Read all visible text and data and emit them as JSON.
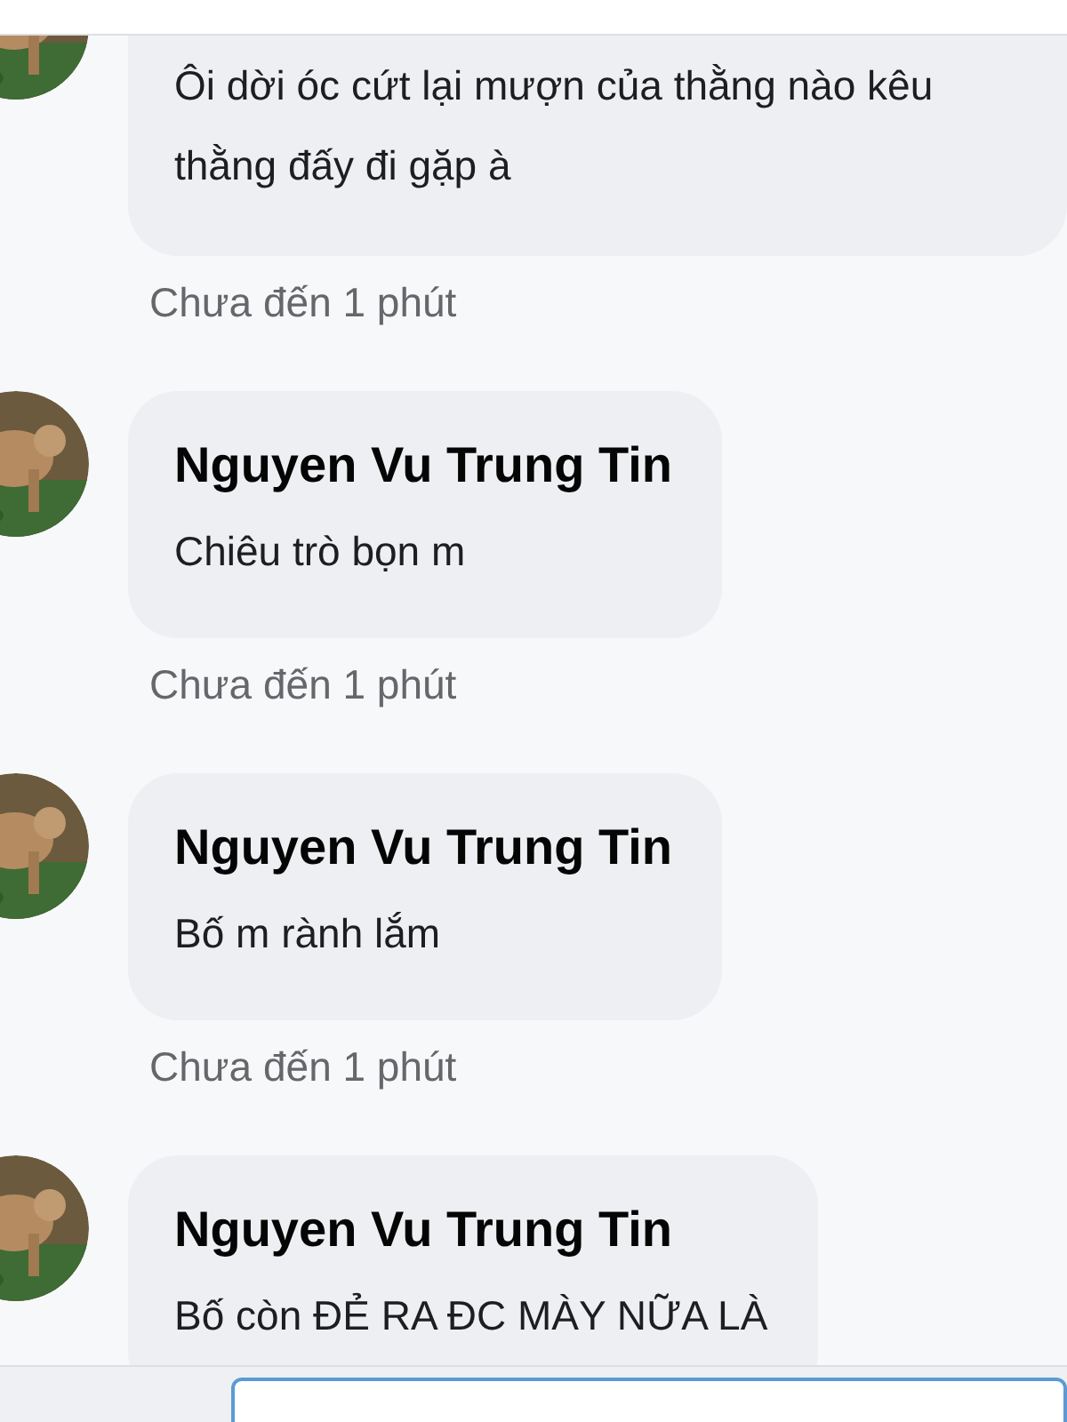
{
  "comments": [
    {
      "text": "Ôi dời óc cứt lại mượn của thằng nào kêu thằng đấy đi gặp à",
      "time": "Chưa đến 1 phút"
    },
    {
      "author": "Nguyen Vu Trung Tin",
      "text": "Chiêu trò bọn m",
      "time": "Chưa đến 1 phút"
    },
    {
      "author": "Nguyen Vu Trung Tin",
      "text": "Bố m rành lắm",
      "time": "Chưa đến 1 phút"
    },
    {
      "author": "Nguyen Vu Trung Tin",
      "text": "Bố còn ĐẺ RA ĐC MÀY NỮA LÀ"
    }
  ]
}
